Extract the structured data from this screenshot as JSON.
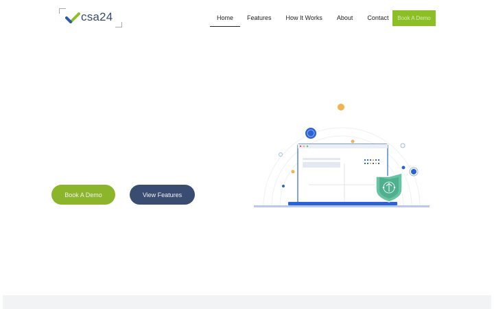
{
  "brand": {
    "name": "csa24",
    "accent": "#8cbf26",
    "navy": "#3b4c73"
  },
  "nav": {
    "items": [
      {
        "label": "Home",
        "active": true
      },
      {
        "label": "Features",
        "active": false
      },
      {
        "label": "How It Works",
        "active": false
      },
      {
        "label": "About",
        "active": false
      },
      {
        "label": "Contact",
        "active": false
      }
    ]
  },
  "header": {
    "cta_label": "Book A Demo"
  },
  "hero": {
    "primary_label": "Book A Demo",
    "secondary_label": "View Features",
    "illustration_icon": "laptop-shield-illustration"
  }
}
